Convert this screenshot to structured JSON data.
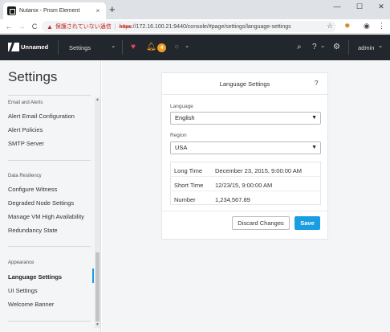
{
  "browser": {
    "tab_title": "Nutanix - Prism Element",
    "tab_close": "×",
    "new_tab": "+",
    "window_controls": [
      "—",
      "☐",
      "✕"
    ],
    "nav": {
      "back": "←",
      "forward": "→",
      "reload": "C"
    },
    "security_warning": "保護されていない通信",
    "url_scheme": "https",
    "url_rest": "://172.16.100.21:9440/console/#page/settings/language-settings",
    "star": "☆"
  },
  "app_header": {
    "cluster_name": "Unnamed",
    "section": "Settings",
    "alert_count": "4",
    "user": "admin",
    "chevron": "⌄"
  },
  "sidebar": {
    "title": "Settings",
    "groups": [
      {
        "heading": "Email and Alerts",
        "items": [
          "Alert Email Configuration",
          "Alert Policies",
          "SMTP Server"
        ]
      },
      {
        "heading": "Data Resiliency",
        "items": [
          "Configure Witness",
          "Degraded Node Settings",
          "Manage VM High Availability",
          "Redundancy State"
        ]
      },
      {
        "heading": "Appearance",
        "items": [
          "Language Settings",
          "UI Settings",
          "Welcome Banner"
        ]
      }
    ],
    "active_item": "Language Settings"
  },
  "panel": {
    "title": "Language Settings",
    "help": "?",
    "language_label": "Language",
    "language_value": "English",
    "region_label": "Region",
    "region_value": "USA",
    "formats": [
      {
        "key": "Long Time",
        "value": "December 23, 2015, 9:00:00 AM"
      },
      {
        "key": "Short Time",
        "value": "12/23/15, 9:00:00 AM"
      },
      {
        "key": "Number",
        "value": "1,234,567.89"
      }
    ],
    "discard_label": "Discard Changes",
    "save_label": "Save"
  },
  "colors": {
    "header_bg": "#22272e",
    "accent": "#1b9de2",
    "alert_badge": "#f0a020",
    "warning_red": "#c5221f"
  }
}
